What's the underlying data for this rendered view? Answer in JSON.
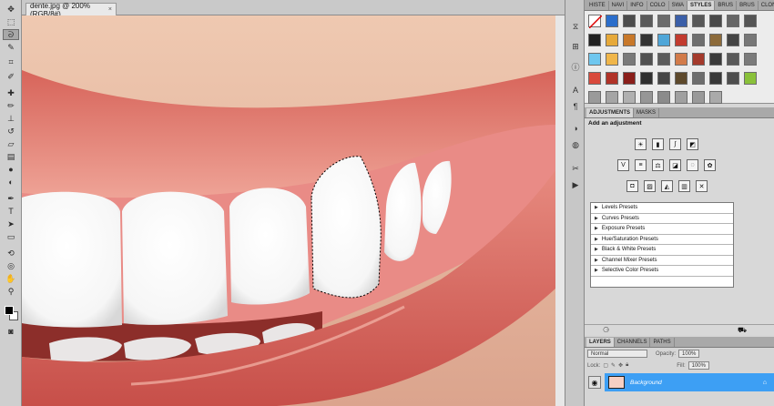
{
  "document": {
    "tab_title": "dente.jpg @ 200% (RGB/8#)",
    "close_glyph": "×"
  },
  "tools": {
    "items": [
      "move-tool",
      "marquee-tool",
      "lasso-tool",
      "quick-selection-tool",
      "crop-tool",
      "eyedropper-tool",
      "healing-brush-tool",
      "brush-tool",
      "clone-stamp-tool",
      "history-brush-tool",
      "eraser-tool",
      "gradient-tool",
      "blur-tool",
      "dodge-tool",
      "pen-tool",
      "type-tool",
      "path-selection-tool",
      "shape-tool",
      "3d-rotate-tool",
      "3d-orbit-tool",
      "hand-tool",
      "zoom-tool"
    ]
  },
  "panels": {
    "top_tabs": [
      "HISTE",
      "NAVI",
      "INFO",
      "COLO",
      "SWA",
      "STYLES",
      "BRUS",
      "BRUS",
      "CLONE"
    ],
    "active_top_tab": "STYLES",
    "adjust_tabs": [
      "ADJUSTMENTS",
      "MASKS"
    ],
    "adjust_title": "Add an adjustment",
    "presets": [
      "Levels Presets",
      "Curves Presets",
      "Exposure Presets",
      "Hue/Saturation Presets",
      "Black & White Presets",
      "Channel Mixer Presets",
      "Selective Color Presets"
    ],
    "layer_tabs": [
      "LAYERS",
      "CHANNELS",
      "PATHS"
    ],
    "blend_mode": "Normal",
    "opacity_label": "Opacity:",
    "opacity_value": "100%",
    "lock_label": "Lock:",
    "fill_label": "Fill:",
    "fill_value": "100%",
    "layer_name": "Background"
  },
  "colors": {
    "accent_selected": "#3d9ff4",
    "panel_bg": "#d6d6d6"
  }
}
